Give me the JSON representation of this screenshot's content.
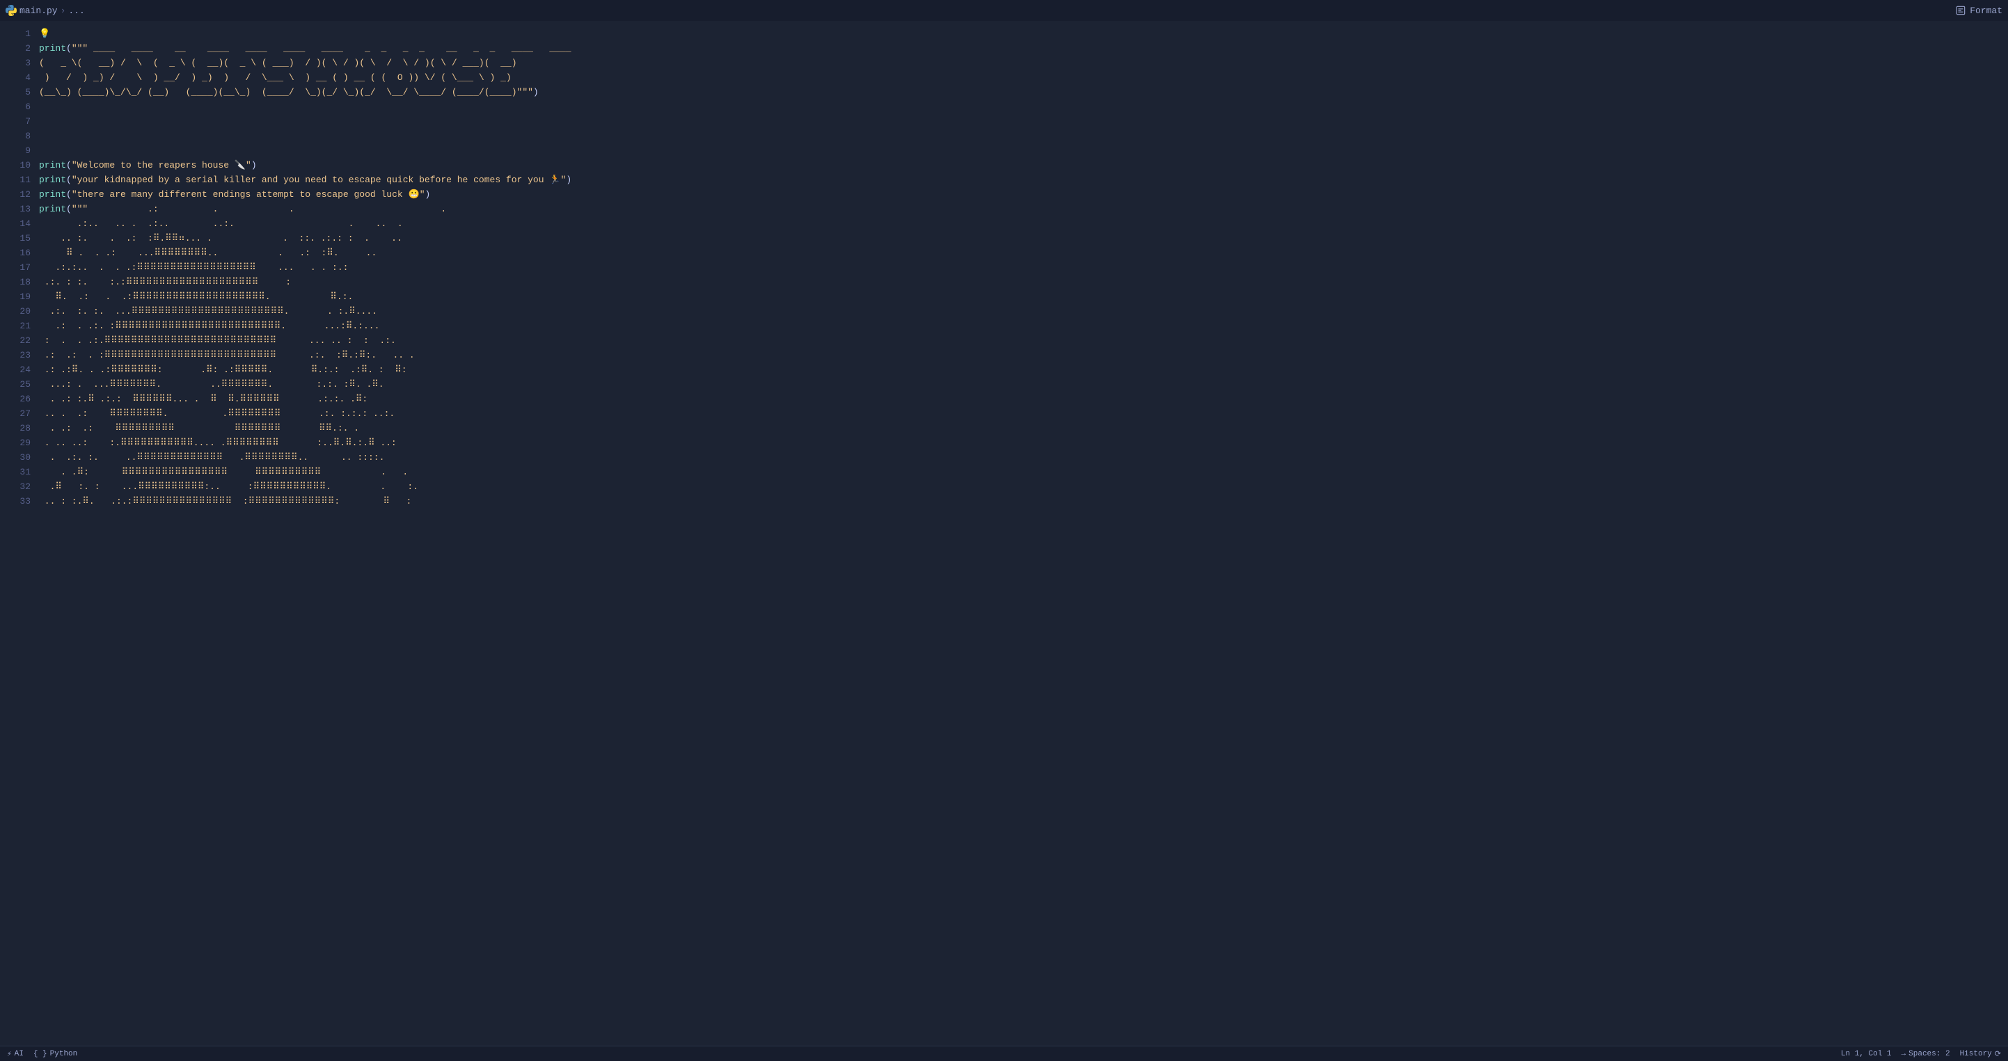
{
  "tabbar": {
    "filename": "main.py",
    "breadcrumb_sep": "›",
    "breadcrumb_more": "...",
    "format_label": "Format"
  },
  "gutter": {
    "lines": [
      "1",
      "2",
      "3",
      "4",
      "5",
      "6",
      "7",
      "8",
      "9",
      "10",
      "11",
      "12",
      "13",
      "14",
      "15",
      "16",
      "17",
      "18",
      "19",
      "20",
      "21",
      "22",
      "23",
      "24",
      "25",
      "26",
      "27",
      "28",
      "29",
      "30",
      "31",
      "32",
      "33"
    ]
  },
  "code": {
    "line1_emoji": "💡",
    "print_fn": "print",
    "tdq": "\"\"\"",
    "dq": "\"",
    "paren_open": "(",
    "paren_close": ")",
    "banner_l2": " ____   ____    __    ____   ____   ____   ____    _  _   _  _    __   _  _   ____   ____ ",
    "banner_l3": "(   _ \\(   __) /  \\  (  _ \\ (  __)(  _ \\ ( ___)  / )( \\ / )( \\  /  \\ / )( \\ / ___)(  __)",
    "banner_l4": " )   /  ) _) /    \\  ) __/  ) _)  )   /  \\___ \\  ) __ ( ) __ ( (  O )) \\/ ( \\___ \\ ) _) ",
    "banner_l5": "(__\\_) (____)\\_/\\_/ (__)   (____)(__\\_)  (____/  \\_)(_/ \\_)(_/  \\__/ \\____/ (____/(____)",
    "str10": "Welcome to the reapers house 🔪",
    "str11": "your kidnapped by a serial killer and you need to escape quick before he comes for you 🏃",
    "str12": "there are many different endings attempt to escape good luck 😬",
    "art13": "           .:          .             .                           .",
    "art14": "       .:..   .. .  .:..        ..:.                     .    ..  .",
    "art15": "    .. :.    .  .:  :⠿.⠿⠿⠶... .             .  ::. .:.: :  .    ..",
    "art16": "     ⠿ .  . .:    ...⠿⠿⠿⠿⠿⠿⠿⠿..           .   .:  :⠿.     ..",
    "art17": "   .:.:..  .  . .:⠿⠿⠿⠿⠿⠿⠿⠿⠿⠿⠿⠿⠿⠿⠿⠿⠿⠿    ...   . . :.:",
    "art18": " .:. : :.    :.:⠿⠿⠿⠿⠿⠿⠿⠿⠿⠿⠿⠿⠿⠿⠿⠿⠿⠿⠿⠿     :",
    "art19": "   ⠿.  .:   .  .:⠿⠿⠿⠿⠿⠿⠿⠿⠿⠿⠿⠿⠿⠿⠿⠿⠿⠿⠿⠿.           ⠿.:.",
    "art20": "  .:.  :. :.  ...⠿⠿⠿⠿⠿⠿⠿⠿⠿⠿⠿⠿⠿⠿⠿⠿⠿⠿⠿⠿⠿⠿⠿.       . :.⠿....",
    "art21": "   .:  . .:. :⠿⠿⠿⠿⠿⠿⠿⠿⠿⠿⠿⠿⠿⠿⠿⠿⠿⠿⠿⠿⠿⠿⠿⠿⠿.       ...:⠿.:...",
    "art22": " :  .  . .:.⠿⠿⠿⠿⠿⠿⠿⠿⠿⠿⠿⠿⠿⠿⠿⠿⠿⠿⠿⠿⠿⠿⠿⠿⠿⠿      ... .. :  :  .:.",
    "art23": " .:  .:  . :⠿⠿⠿⠿⠿⠿⠿⠿⠿⠿⠿⠿⠿⠿⠿⠿⠿⠿⠿⠿⠿⠿⠿⠿⠿⠿      .:.  :⠿.:⠿:.   .. .",
    "art24": " .: .:⠿. . .:⠿⠿⠿⠿⠿⠿⠿:       .⠿: .:⠿⠿⠿⠿⠿.       ⠿.:.:  .:⠿. :  ⠿:",
    "art25": "  ...: .  ...⠿⠿⠿⠿⠿⠿⠿.         ..⠿⠿⠿⠿⠿⠿⠿.        :.:. :⠿. .⠿.",
    "art26": "  . .: :.⠿ .:.:  ⠿⠿⠿⠿⠿⠿... .  ⠿  ⠿.⠿⠿⠿⠿⠿⠿       .:.:. .⠿:",
    "art27": " .. .  .:    ⠿⠿⠿⠿⠿⠿⠿⠿.          .⠿⠿⠿⠿⠿⠿⠿⠿       .:. :.:.: ..:.",
    "art28": "  . .:  .:    ⠿⠿⠿⠿⠿⠿⠿⠿⠿           ⠿⠿⠿⠿⠿⠿⠿       ⠿⠿.:. .",
    "art29": " . .. ..:    :.⠿⠿⠿⠿⠿⠿⠿⠿⠿⠿⠿.... .⠿⠿⠿⠿⠿⠿⠿⠿       :..⠿.⠿.:.⠿ ..:",
    "art30": "  .  .:. :.     ..⠿⠿⠿⠿⠿⠿⠿⠿⠿⠿⠿⠿⠿   .⠿⠿⠿⠿⠿⠿⠿⠿..      .. ::::.",
    "art31": "    . .⠿:      ⠿⠿⠿⠿⠿⠿⠿⠿⠿⠿⠿⠿⠿⠿⠿⠿     ⠿⠿⠿⠿⠿⠿⠿⠿⠿⠿           .   .",
    "art32": "  .⠿   :. :    ...⠿⠿⠿⠿⠿⠿⠿⠿⠿⠿:..     :⠿⠿⠿⠿⠿⠿⠿⠿⠿⠿⠿.         .    :.",
    "art33": " .. : :.⠿.   .:.:⠿⠿⠿⠿⠿⠿⠿⠿⠿⠿⠿⠿⠿⠿⠿  :⠿⠿⠿⠿⠿⠿⠿⠿⠿⠿⠿⠿⠿:        ⠿   :"
  },
  "status": {
    "ai": "AI",
    "language": "Python",
    "ln_col": "Ln 1, Col 1",
    "spaces": "Spaces: 2",
    "history": "History"
  }
}
